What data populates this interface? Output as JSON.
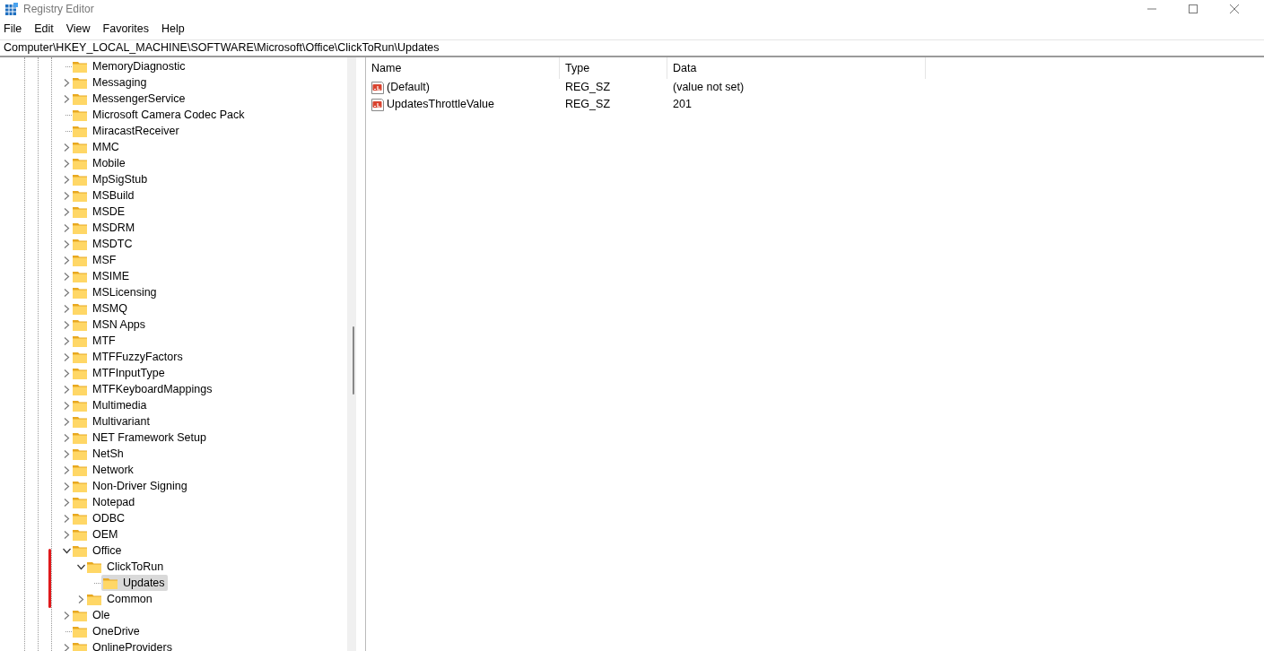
{
  "window": {
    "title": "Registry Editor"
  },
  "menu": [
    "File",
    "Edit",
    "View",
    "Favorites",
    "Help"
  ],
  "address": "Computer\\HKEY_LOCAL_MACHINE\\SOFTWARE\\Microsoft\\Office\\ClickToRun\\Updates",
  "tree": [
    {
      "label": "MemoryDiagnostic",
      "has_children": false,
      "selected": false
    },
    {
      "label": "Messaging",
      "has_children": true,
      "expanded": false,
      "selected": false
    },
    {
      "label": "MessengerService",
      "has_children": true,
      "expanded": false,
      "selected": false
    },
    {
      "label": "Microsoft Camera Codec Pack",
      "has_children": false,
      "selected": false
    },
    {
      "label": "MiracastReceiver",
      "has_children": false,
      "selected": false
    },
    {
      "label": "MMC",
      "has_children": true,
      "expanded": false,
      "selected": false
    },
    {
      "label": "Mobile",
      "has_children": true,
      "expanded": false,
      "selected": false
    },
    {
      "label": "MpSigStub",
      "has_children": true,
      "expanded": false,
      "selected": false
    },
    {
      "label": "MSBuild",
      "has_children": true,
      "expanded": false,
      "selected": false
    },
    {
      "label": "MSDE",
      "has_children": true,
      "expanded": false,
      "selected": false
    },
    {
      "label": "MSDRM",
      "has_children": true,
      "expanded": false,
      "selected": false
    },
    {
      "label": "MSDTC",
      "has_children": true,
      "expanded": false,
      "selected": false
    },
    {
      "label": "MSF",
      "has_children": true,
      "expanded": false,
      "selected": false
    },
    {
      "label": "MSIME",
      "has_children": true,
      "expanded": false,
      "selected": false
    },
    {
      "label": "MSLicensing",
      "has_children": true,
      "expanded": false,
      "selected": false
    },
    {
      "label": "MSMQ",
      "has_children": true,
      "expanded": false,
      "selected": false
    },
    {
      "label": "MSN Apps",
      "has_children": true,
      "expanded": false,
      "selected": false
    },
    {
      "label": "MTF",
      "has_children": true,
      "expanded": false,
      "selected": false
    },
    {
      "label": "MTFFuzzyFactors",
      "has_children": true,
      "expanded": false,
      "selected": false
    },
    {
      "label": "MTFInputType",
      "has_children": true,
      "expanded": false,
      "selected": false
    },
    {
      "label": "MTFKeyboardMappings",
      "has_children": true,
      "expanded": false,
      "selected": false
    },
    {
      "label": "Multimedia",
      "has_children": true,
      "expanded": false,
      "selected": false
    },
    {
      "label": "Multivariant",
      "has_children": true,
      "expanded": false,
      "selected": false
    },
    {
      "label": "NET Framework Setup",
      "has_children": true,
      "expanded": false,
      "selected": false
    },
    {
      "label": "NetSh",
      "has_children": true,
      "expanded": false,
      "selected": false
    },
    {
      "label": "Network",
      "has_children": true,
      "expanded": false,
      "selected": false
    },
    {
      "label": "Non-Driver Signing",
      "has_children": true,
      "expanded": false,
      "selected": false
    },
    {
      "label": "Notepad",
      "has_children": true,
      "expanded": false,
      "selected": false
    },
    {
      "label": "ODBC",
      "has_children": true,
      "expanded": false,
      "selected": false
    },
    {
      "label": "OEM",
      "has_children": true,
      "expanded": false,
      "selected": false
    },
    {
      "label": "Office",
      "has_children": true,
      "expanded": true,
      "selected": false,
      "children": [
        {
          "label": "ClickToRun",
          "has_children": true,
          "expanded": true,
          "selected": false,
          "children": [
            {
              "label": "Updates",
              "has_children": false,
              "selected": true
            }
          ]
        },
        {
          "label": "Common",
          "has_children": true,
          "expanded": false,
          "selected": false
        }
      ]
    },
    {
      "label": "Ole",
      "has_children": true,
      "expanded": false,
      "selected": false
    },
    {
      "label": "OneDrive",
      "has_children": false,
      "selected": false
    },
    {
      "label": "OnlineProviders",
      "has_children": true,
      "expanded": false,
      "selected": false
    }
  ],
  "values": {
    "columns": [
      "Name",
      "Type",
      "Data"
    ],
    "rows": [
      {
        "name": "(Default)",
        "type": "REG_SZ",
        "data": "(value not set)"
      },
      {
        "name": "UpdatesThrottleValue",
        "type": "REG_SZ",
        "data": "201"
      }
    ]
  }
}
